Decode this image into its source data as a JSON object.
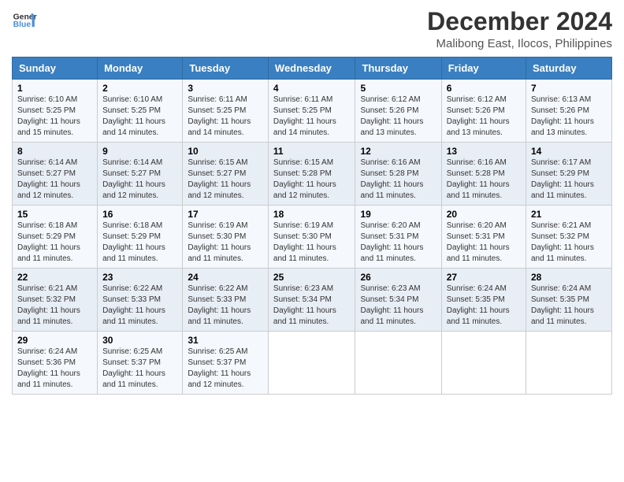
{
  "logo": {
    "line1": "General",
    "line2": "Blue"
  },
  "title": "December 2024",
  "subtitle": "Malibong East, Ilocos, Philippines",
  "days_of_week": [
    "Sunday",
    "Monday",
    "Tuesday",
    "Wednesday",
    "Thursday",
    "Friday",
    "Saturday"
  ],
  "weeks": [
    [
      {
        "day": "1",
        "sunrise": "6:10 AM",
        "sunset": "5:25 PM",
        "daylight": "11 hours and 15 minutes."
      },
      {
        "day": "2",
        "sunrise": "6:10 AM",
        "sunset": "5:25 PM",
        "daylight": "11 hours and 14 minutes."
      },
      {
        "day": "3",
        "sunrise": "6:11 AM",
        "sunset": "5:25 PM",
        "daylight": "11 hours and 14 minutes."
      },
      {
        "day": "4",
        "sunrise": "6:11 AM",
        "sunset": "5:25 PM",
        "daylight": "11 hours and 14 minutes."
      },
      {
        "day": "5",
        "sunrise": "6:12 AM",
        "sunset": "5:26 PM",
        "daylight": "11 hours and 13 minutes."
      },
      {
        "day": "6",
        "sunrise": "6:12 AM",
        "sunset": "5:26 PM",
        "daylight": "11 hours and 13 minutes."
      },
      {
        "day": "7",
        "sunrise": "6:13 AM",
        "sunset": "5:26 PM",
        "daylight": "11 hours and 13 minutes."
      }
    ],
    [
      {
        "day": "8",
        "sunrise": "6:14 AM",
        "sunset": "5:27 PM",
        "daylight": "11 hours and 12 minutes."
      },
      {
        "day": "9",
        "sunrise": "6:14 AM",
        "sunset": "5:27 PM",
        "daylight": "11 hours and 12 minutes."
      },
      {
        "day": "10",
        "sunrise": "6:15 AM",
        "sunset": "5:27 PM",
        "daylight": "11 hours and 12 minutes."
      },
      {
        "day": "11",
        "sunrise": "6:15 AM",
        "sunset": "5:28 PM",
        "daylight": "11 hours and 12 minutes."
      },
      {
        "day": "12",
        "sunrise": "6:16 AM",
        "sunset": "5:28 PM",
        "daylight": "11 hours and 11 minutes."
      },
      {
        "day": "13",
        "sunrise": "6:16 AM",
        "sunset": "5:28 PM",
        "daylight": "11 hours and 11 minutes."
      },
      {
        "day": "14",
        "sunrise": "6:17 AM",
        "sunset": "5:29 PM",
        "daylight": "11 hours and 11 minutes."
      }
    ],
    [
      {
        "day": "15",
        "sunrise": "6:18 AM",
        "sunset": "5:29 PM",
        "daylight": "11 hours and 11 minutes."
      },
      {
        "day": "16",
        "sunrise": "6:18 AM",
        "sunset": "5:29 PM",
        "daylight": "11 hours and 11 minutes."
      },
      {
        "day": "17",
        "sunrise": "6:19 AM",
        "sunset": "5:30 PM",
        "daylight": "11 hours and 11 minutes."
      },
      {
        "day": "18",
        "sunrise": "6:19 AM",
        "sunset": "5:30 PM",
        "daylight": "11 hours and 11 minutes."
      },
      {
        "day": "19",
        "sunrise": "6:20 AM",
        "sunset": "5:31 PM",
        "daylight": "11 hours and 11 minutes."
      },
      {
        "day": "20",
        "sunrise": "6:20 AM",
        "sunset": "5:31 PM",
        "daylight": "11 hours and 11 minutes."
      },
      {
        "day": "21",
        "sunrise": "6:21 AM",
        "sunset": "5:32 PM",
        "daylight": "11 hours and 11 minutes."
      }
    ],
    [
      {
        "day": "22",
        "sunrise": "6:21 AM",
        "sunset": "5:32 PM",
        "daylight": "11 hours and 11 minutes."
      },
      {
        "day": "23",
        "sunrise": "6:22 AM",
        "sunset": "5:33 PM",
        "daylight": "11 hours and 11 minutes."
      },
      {
        "day": "24",
        "sunrise": "6:22 AM",
        "sunset": "5:33 PM",
        "daylight": "11 hours and 11 minutes."
      },
      {
        "day": "25",
        "sunrise": "6:23 AM",
        "sunset": "5:34 PM",
        "daylight": "11 hours and 11 minutes."
      },
      {
        "day": "26",
        "sunrise": "6:23 AM",
        "sunset": "5:34 PM",
        "daylight": "11 hours and 11 minutes."
      },
      {
        "day": "27",
        "sunrise": "6:24 AM",
        "sunset": "5:35 PM",
        "daylight": "11 hours and 11 minutes."
      },
      {
        "day": "28",
        "sunrise": "6:24 AM",
        "sunset": "5:35 PM",
        "daylight": "11 hours and 11 minutes."
      }
    ],
    [
      {
        "day": "29",
        "sunrise": "6:24 AM",
        "sunset": "5:36 PM",
        "daylight": "11 hours and 11 minutes."
      },
      {
        "day": "30",
        "sunrise": "6:25 AM",
        "sunset": "5:37 PM",
        "daylight": "11 hours and 11 minutes."
      },
      {
        "day": "31",
        "sunrise": "6:25 AM",
        "sunset": "5:37 PM",
        "daylight": "11 hours and 12 minutes."
      },
      null,
      null,
      null,
      null
    ]
  ],
  "labels": {
    "sunrise": "Sunrise:",
    "sunset": "Sunset:",
    "daylight": "Daylight:"
  }
}
